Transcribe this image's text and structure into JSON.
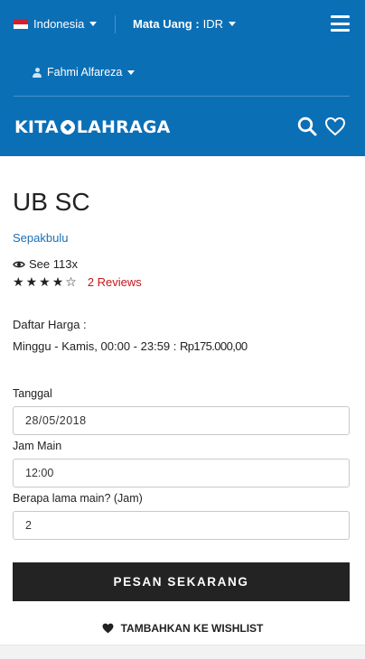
{
  "topbar": {
    "language": "Indonesia",
    "currency_label": "Mata Uang :",
    "currency_value": "IDR",
    "user_name": "Fahmi Alfareza"
  },
  "brand": {
    "left": "KITA",
    "right": "LAHRAGA",
    "color": "#0b6fb6"
  },
  "venue": {
    "title": "UB SC",
    "category": "Sepakbulu",
    "views": "See 113x",
    "stars_filled": 4,
    "stars_total": 5,
    "reviews": "2 Reviews"
  },
  "pricing": {
    "label": "Daftar Harga :",
    "schedule": "Minggu - Kamis, 00:00 - 23:59 : ",
    "amount": "Rp175.000,00"
  },
  "form": {
    "date_label": "Tanggal",
    "date_value": "28/05/2018",
    "time_label": "Jam Main",
    "time_value": "12:00",
    "duration_label": "Berapa lama main? (Jam)",
    "duration_value": "2"
  },
  "actions": {
    "book_label": "PESAN SEKARANG",
    "wishlist_label": "TAMBAHKAN KE WISHLIST"
  }
}
